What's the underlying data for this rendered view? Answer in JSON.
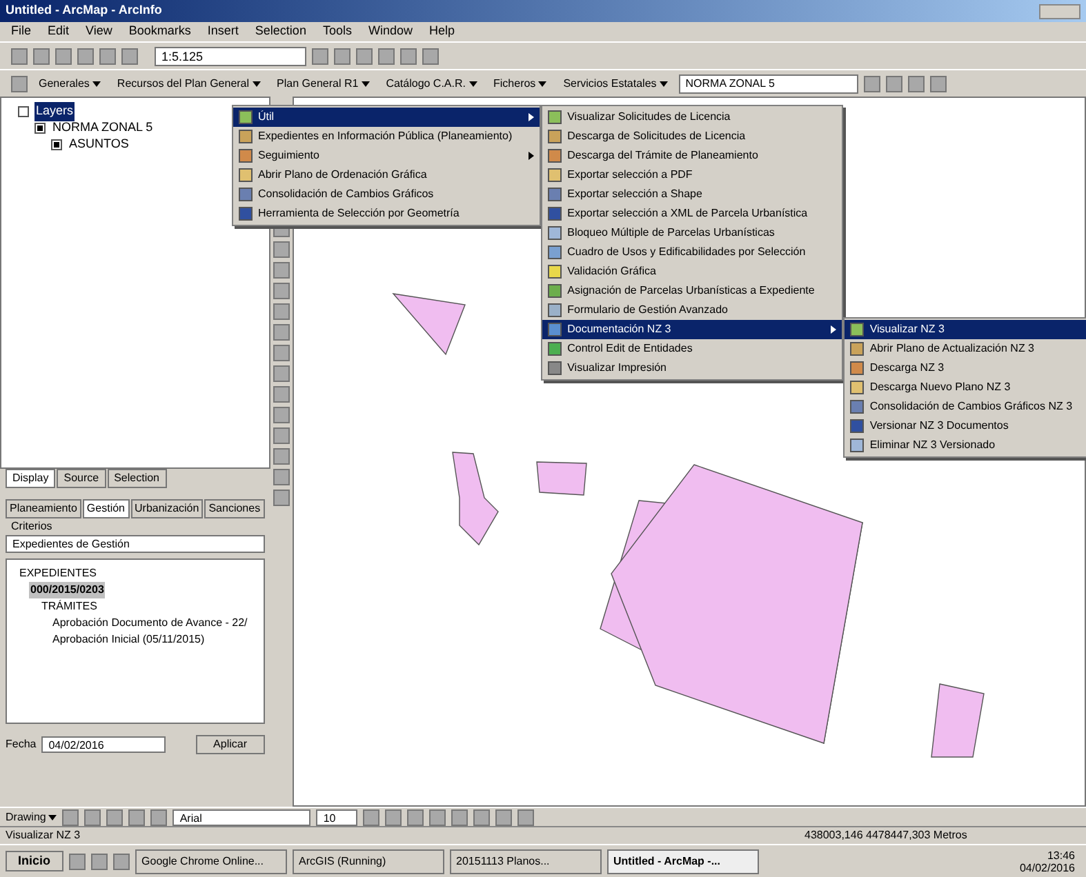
{
  "window": {
    "title": "Untitled - ArcMap - ArcInfo"
  },
  "menubar": [
    "File",
    "Edit",
    "View",
    "Bookmarks",
    "Insert",
    "Selection",
    "Tools",
    "Window",
    "Help"
  ],
  "standard_toolbar": {
    "scale": "1:5.125"
  },
  "custom_toolbar": {
    "menus": [
      {
        "label": "Generales"
      },
      {
        "label": "Recursos del Plan General"
      },
      {
        "label": "Plan General R1"
      },
      {
        "label": "Catálogo C.A.R."
      },
      {
        "label": "Ficheros"
      },
      {
        "label": "Servicios Estatales"
      }
    ],
    "layer": "NORMA ZONAL 5"
  },
  "toc": {
    "tree": [
      {
        "label": "Layers",
        "selected": true,
        "checked": false,
        "children": [
          {
            "label": "NORMA ZONAL 5",
            "selected": false,
            "checked": true,
            "children": [
              {
                "label": "ASUNTOS",
                "selected": false,
                "checked": true
              }
            ]
          }
        ]
      }
    ],
    "tabs": [
      {
        "label": "Display",
        "selected": true
      },
      {
        "label": "Source",
        "selected": false
      },
      {
        "label": "Selection",
        "selected": false
      }
    ]
  },
  "gestion_panel": {
    "tabs": [
      {
        "label": "Planeamiento",
        "selected": false
      },
      {
        "label": "Gestión",
        "selected": true
      },
      {
        "label": "Urbanización",
        "selected": false
      },
      {
        "label": "Sanciones",
        "selected": false
      }
    ],
    "criteria_label": "Criterios",
    "criteria_value": "Expedientes de Gestión",
    "tree": [
      {
        "label": "EXPEDIENTES",
        "selected": false,
        "children": [
          {
            "label": "000/2015/0203",
            "selected": true,
            "children": [
              {
                "label": "TRÁMITES",
                "selected": false,
                "children": [
                  {
                    "label": "Aprobación Documento de Avance - 22/",
                    "selected": false
                  },
                  {
                    "label": "Aprobación Inicial (05/11/2015)",
                    "selected": false
                  }
                ]
              }
            ]
          }
        ]
      }
    ],
    "date_label": "Fecha",
    "date_value": "04/02/2016",
    "apply_button": "Aplicar"
  },
  "menu": [
    {
      "label": "Útil",
      "selected": true,
      "submenu": true
    },
    {
      "label": "Expedientes en Información Pública (Planeamiento)",
      "selected": false,
      "submenu": false
    },
    {
      "label": "Seguimiento",
      "selected": false,
      "submenu": true
    },
    {
      "label": "Abrir Plano de Ordenación Gráfica",
      "selected": false,
      "submenu": false
    },
    {
      "label": "Consolidación de Cambios Gráficos",
      "selected": false,
      "submenu": false
    },
    {
      "label": "Herramienta de Selección por Geometría",
      "selected": false,
      "submenu": false
    }
  ],
  "submenu": [
    {
      "label": "Visualizar Solicitudes de Licencia",
      "selected": false,
      "submenu": false
    },
    {
      "label": "Descarga de Solicitudes de Licencia",
      "selected": false,
      "submenu": false
    },
    {
      "label": "Descarga del Trámite de Planeamiento",
      "selected": false,
      "submenu": false
    },
    {
      "label": "Exportar selección a PDF",
      "selected": false,
      "submenu": false
    },
    {
      "label": "Exportar selección a Shape",
      "selected": false,
      "submenu": false
    },
    {
      "label": "Exportar selección a XML de Parcela Urbanística",
      "selected": false,
      "submenu": false
    },
    {
      "label": "Bloqueo Múltiple de Parcelas Urbanísticas",
      "selected": false,
      "submenu": false
    },
    {
      "label": "Cuadro de Usos y Edificabilidades por Selección",
      "selected": false,
      "submenu": false
    },
    {
      "label": "Validación Gráfica",
      "selected": false,
      "submenu": false
    },
    {
      "label": "Asignación de Parcelas Urbanísticas a Expediente",
      "selected": false,
      "submenu": false
    },
    {
      "label": "Formulario de Gestión Avanzado",
      "selected": false,
      "submenu": false
    },
    {
      "label": "Documentación NZ 3",
      "selected": true,
      "submenu": true
    },
    {
      "label": "Control Edit de Entidades",
      "selected": false,
      "submenu": false
    },
    {
      "label": "Visualizar Impresión",
      "selected": false,
      "submenu": false
    }
  ],
  "subsubmenu": [
    {
      "label": "Visualizar NZ 3",
      "selected": true
    },
    {
      "label": "Abrir Plano de Actualización NZ 3",
      "selected": false
    },
    {
      "label": "Descarga NZ 3",
      "selected": false
    },
    {
      "label": "Descarga Nuevo Plano NZ 3",
      "selected": false
    },
    {
      "label": "Consolidación de Cambios Gráficos NZ 3",
      "selected": false
    },
    {
      "label": "Versionar NZ 3 Documentos",
      "selected": false
    },
    {
      "label": "Eliminar NZ 3 Versionado",
      "selected": false
    }
  ],
  "drawing_toolbar": {
    "menu": "Drawing",
    "font": "Arial",
    "size": "10"
  },
  "status_bar": {
    "message": "Visualizar NZ 3",
    "coordinates": "438003,146  4478447,303 Metros"
  },
  "taskbar": {
    "start": "Inicio",
    "tasks": [
      {
        "label": "Google Chrome Online...",
        "selected": false
      },
      {
        "label": "ArcGIS (Running)",
        "selected": false
      },
      {
        "label": "20151113 Planos...",
        "selected": false
      },
      {
        "label": "Untitled - ArcMap -...",
        "selected": true
      }
    ],
    "time": "13:46",
    "date": "04/02/2016"
  }
}
